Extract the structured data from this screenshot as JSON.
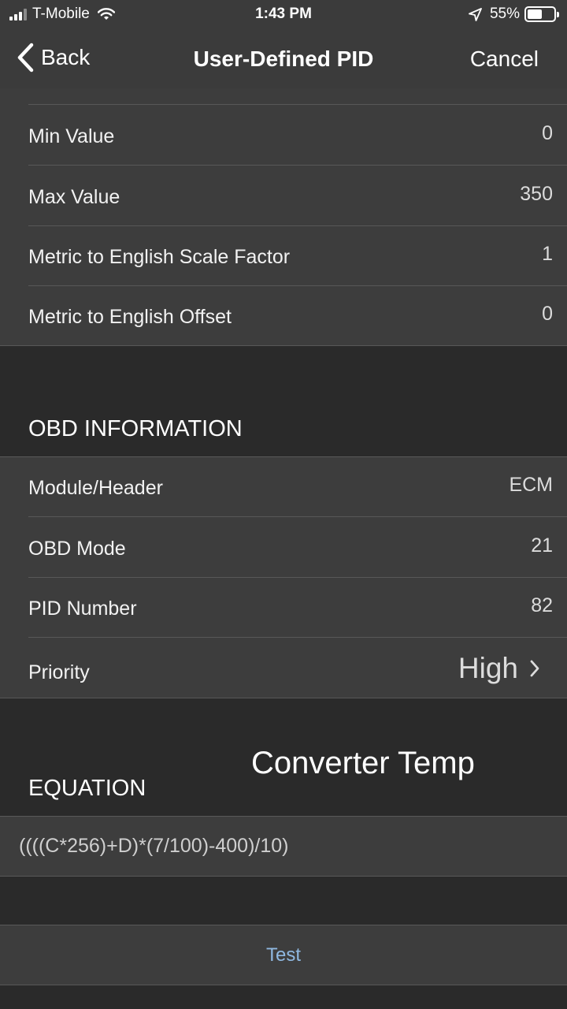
{
  "status_bar": {
    "carrier": "T-Mobile",
    "time": "1:43 PM",
    "battery": "55%",
    "battery_level": 0.55,
    "signal_bars": 3,
    "icons": [
      "signal-icon",
      "wifi-icon",
      "location-arrow-icon",
      "battery-icon"
    ]
  },
  "nav": {
    "back_label": "Back",
    "title": "User-Defined PID",
    "cancel_label": "Cancel"
  },
  "range_rows": [
    {
      "label": "Min Value",
      "value": "0"
    },
    {
      "label": "Max Value",
      "value": "350"
    },
    {
      "label": "Metric to English Scale Factor",
      "value": "1"
    },
    {
      "label": "Metric to English Offset",
      "value": "0"
    }
  ],
  "obd": {
    "header": "OBD INFORMATION",
    "rows": [
      {
        "label": "Module/Header",
        "value": "ECM"
      },
      {
        "label": "OBD Mode",
        "value": "21"
      },
      {
        "label": "PID Number",
        "value": "82"
      }
    ],
    "priority_label": "Priority",
    "priority_value": "High"
  },
  "annotation": "Converter Temp",
  "equation": {
    "header": "EQUATION",
    "value": "((((C*256)+D)*(7/100)-400)/10)"
  },
  "test_label": "Test",
  "colors": {
    "background": "#2a2a2a",
    "cell": "#3d3d3d",
    "bar": "#3b3b3b",
    "link": "#8fb8e0"
  }
}
